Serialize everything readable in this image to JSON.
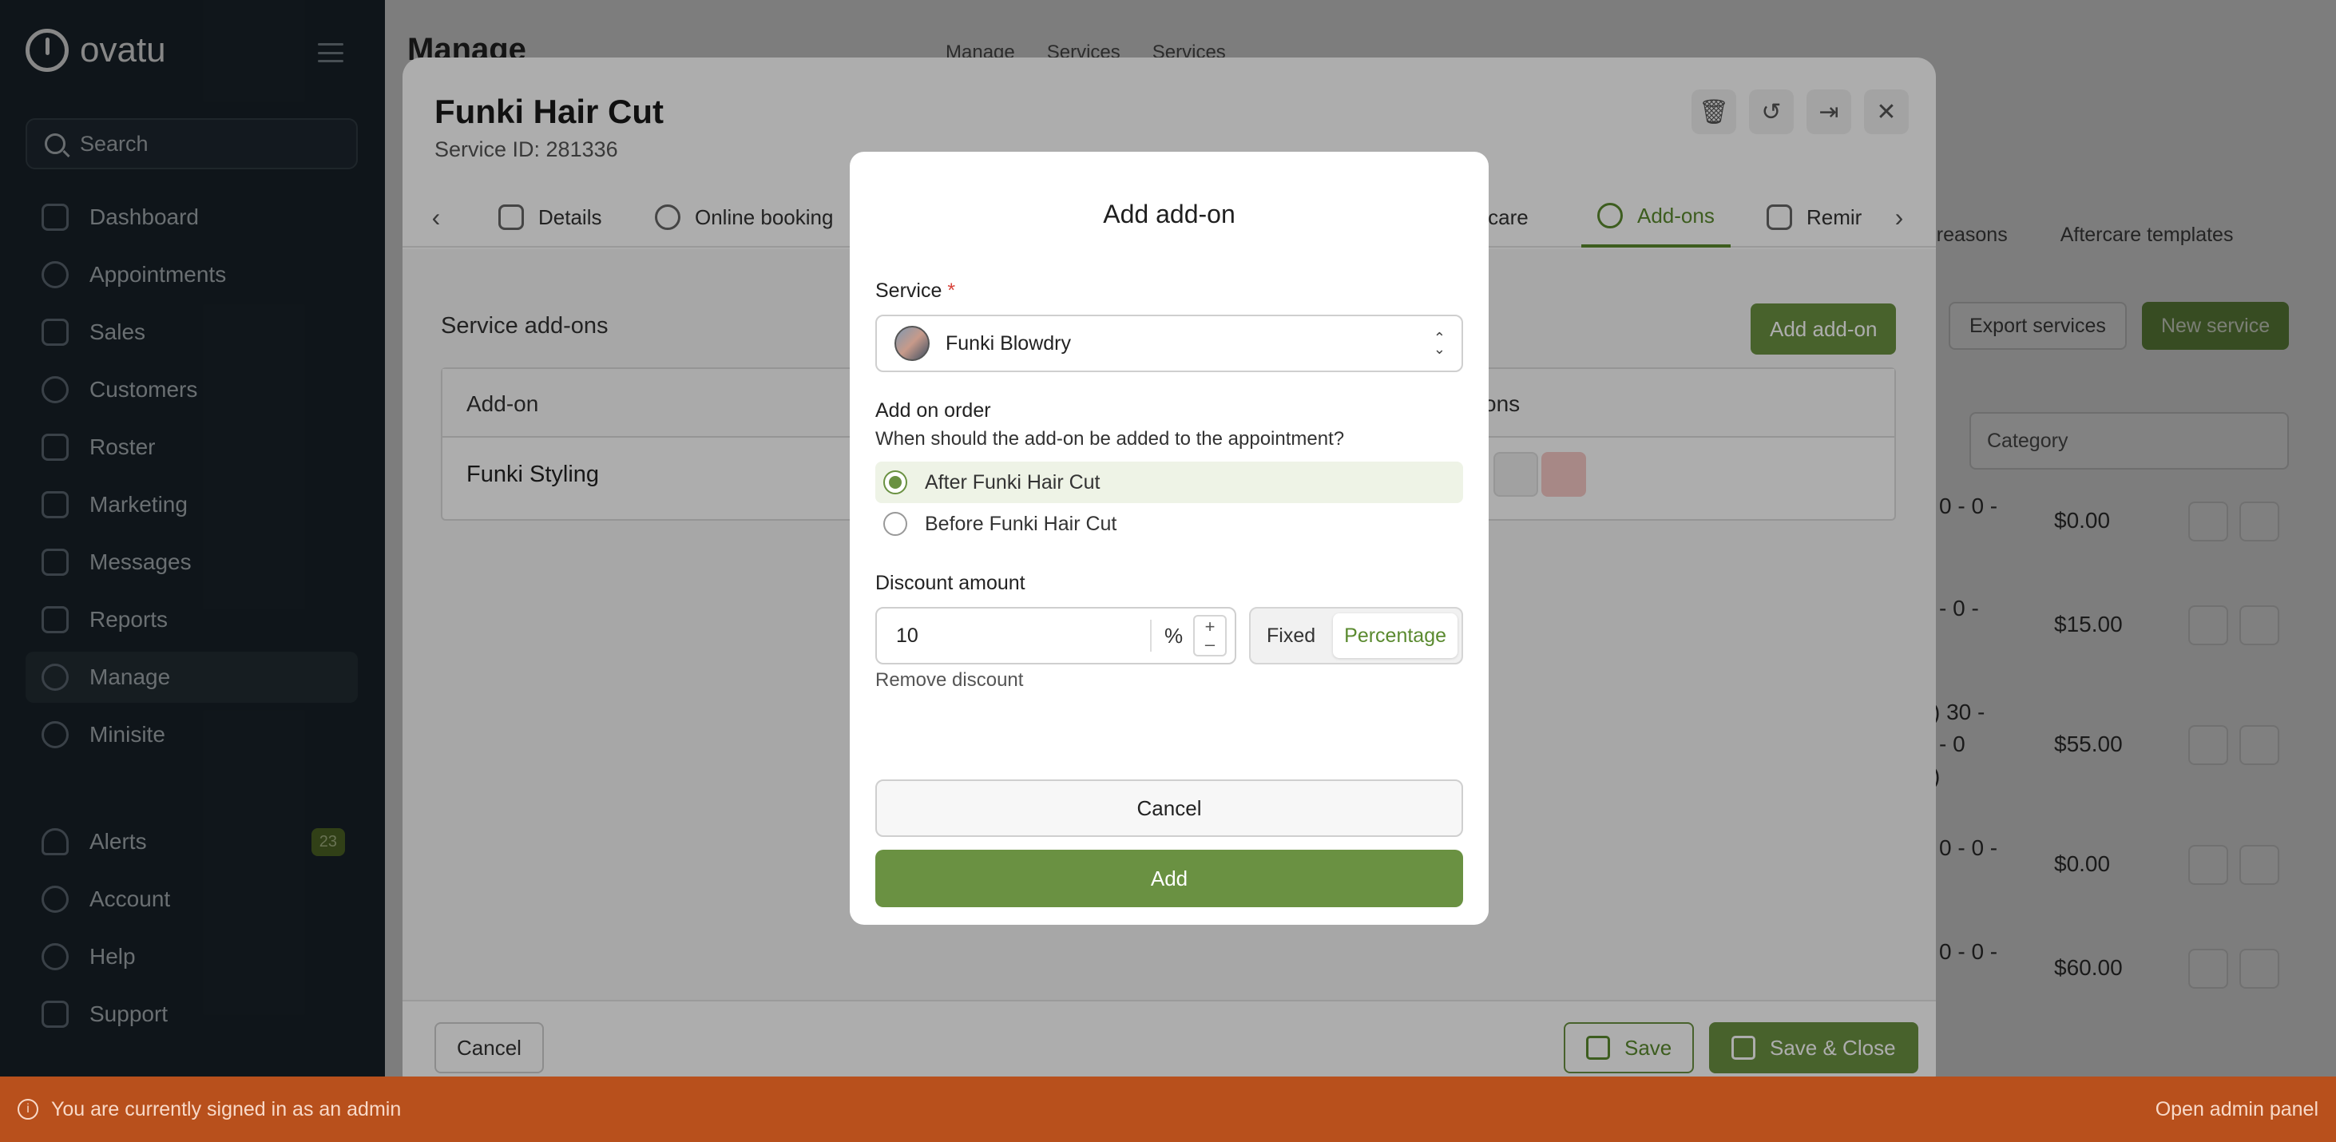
{
  "app": {
    "name": "ovatu"
  },
  "sidebar": {
    "search_placeholder": "Search",
    "items": [
      {
        "label": "Dashboard",
        "icon": "home-icon"
      },
      {
        "label": "Appointments",
        "icon": "clock-icon"
      },
      {
        "label": "Sales",
        "icon": "tag-icon"
      },
      {
        "label": "Customers",
        "icon": "users-icon"
      },
      {
        "label": "Roster",
        "icon": "calendar-icon"
      },
      {
        "label": "Marketing",
        "icon": "megaphone-icon"
      },
      {
        "label": "Messages",
        "icon": "chat-icon"
      },
      {
        "label": "Reports",
        "icon": "chart-icon"
      },
      {
        "label": "Manage",
        "icon": "gear-icon"
      },
      {
        "label": "Minisite",
        "icon": "globe-icon"
      }
    ],
    "bottom_items": [
      {
        "label": "Alerts",
        "icon": "bell-icon",
        "badge": "23"
      },
      {
        "label": "Account",
        "icon": "account-icon"
      },
      {
        "label": "Help",
        "icon": "help-icon"
      },
      {
        "label": "Support",
        "icon": "support-icon"
      }
    ]
  },
  "background": {
    "title": "Manage",
    "breadcrumbs": [
      "Manage",
      "Services",
      "Services"
    ],
    "tabs": [
      "on reasons",
      "Aftercare templates"
    ],
    "export_button": "Export services",
    "new_button": "New service",
    "category_placeholder": "Category",
    "prices": [
      "$0.00",
      "$15.00",
      "$55.00",
      "$0.00",
      "$60.00"
    ],
    "fragments": [
      "0 - 0 -",
      "- 0 -",
      ") 30 -",
      "- 0",
      ")",
      "0 - 0 -",
      "0 - 0 -"
    ]
  },
  "service_modal": {
    "title": "Funki Hair Cut",
    "service_id": "Service ID: 281336",
    "tabs": [
      {
        "label": "Details",
        "icon": "details-icon"
      },
      {
        "label": "Online booking",
        "icon": "globe-icon"
      },
      {
        "label": "ercare",
        "icon": ""
      },
      {
        "label": "Add-ons",
        "icon": "addon-icon"
      },
      {
        "label": "Remir",
        "icon": "hand-icon"
      }
    ],
    "section_title": "Service add-ons",
    "add_addon_button": "Add add-on",
    "table": {
      "col_addon": "Add-on",
      "col_actions": "ctions",
      "rows": [
        {
          "addon": "Funki Styling"
        }
      ]
    },
    "footer": {
      "cancel": "Cancel",
      "save": "Save",
      "save_close": "Save & Close"
    }
  },
  "addon_dialog": {
    "title": "Add add-on",
    "service_label": "Service",
    "required_mark": "*",
    "service_value": "Funki Blowdry",
    "order_label": "Add on order",
    "order_question": "When should the add-on be added to the appointment?",
    "order_options": [
      {
        "label": "After Funki Hair Cut",
        "selected": true
      },
      {
        "label": "Before Funki Hair Cut",
        "selected": false
      }
    ],
    "discount_label": "Discount amount",
    "discount_value": "10",
    "discount_unit": "%",
    "discount_types": [
      "Fixed",
      "Percentage"
    ],
    "discount_type_selected": "Percentage",
    "remove_discount": "Remove discount",
    "cancel_button": "Cancel",
    "add_button": "Add"
  },
  "banner": {
    "message": "You are currently signed in as an admin",
    "link": "Open admin panel"
  },
  "colors": {
    "accent": "#6a9142",
    "sidebar_bg": "#1e2a33",
    "banner_bg": "#b8501c",
    "danger": "#d8433b"
  }
}
